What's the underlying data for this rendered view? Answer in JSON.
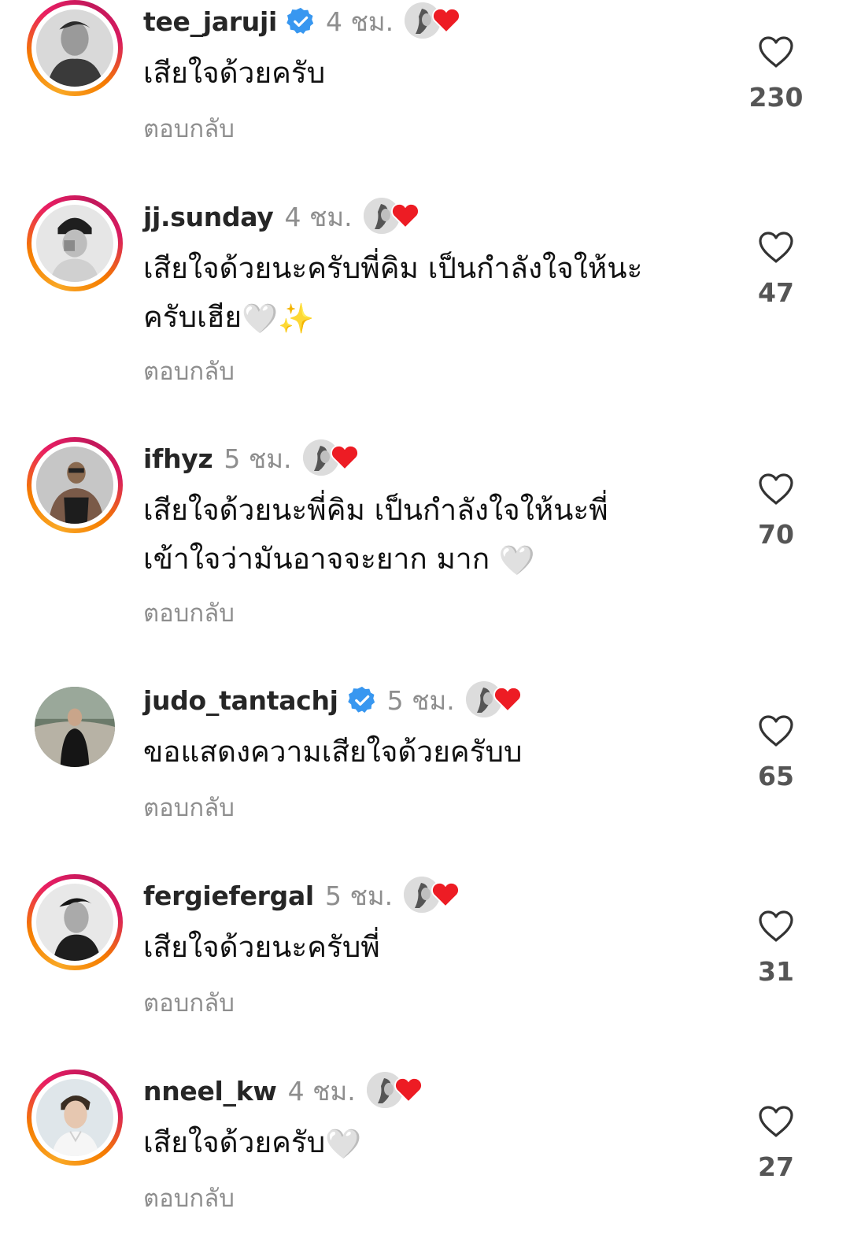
{
  "comments": [
    {
      "username": "tee_jaruji",
      "verified": true,
      "time": "4 ชม.",
      "text": "เสียใจด้วยครับ",
      "emoji_suffix": "",
      "reply_label": "ตอบกลับ",
      "likes": "230",
      "story_ring": true
    },
    {
      "username": "jj.sunday",
      "verified": false,
      "time": "4 ชม.",
      "text_line1": "เสียใจด้วยนะครับพี่คิม เป็นกำลังใจให้นะ",
      "text_line2": "ครับเฮีย",
      "emoji_suffix": "🤍✨",
      "reply_label": "ตอบกลับ",
      "likes": "47",
      "story_ring": true
    },
    {
      "username": "ifhyz",
      "verified": false,
      "time": "5 ชม.",
      "text_line1": "เสียใจด้วยนะพี่คิม เป็นกำลังใจให้นะพี่",
      "text_line2": "เข้าใจว่ามันอาจจะยาก มาก",
      "emoji_suffix": "🤍",
      "reply_label": "ตอบกลับ",
      "likes": "70",
      "story_ring": true
    },
    {
      "username": "judo_tantachj",
      "verified": true,
      "time": "5 ชม.",
      "text": "ขอแสดงความเสียใจด้วยครับบ",
      "emoji_suffix": "",
      "reply_label": "ตอบกลับ",
      "likes": "65",
      "story_ring": false
    },
    {
      "username": "fergiefergal",
      "verified": false,
      "time": "5 ชม.",
      "text": "เสียใจด้วยนะครับพี่",
      "emoji_suffix": "",
      "reply_label": "ตอบกลับ",
      "likes": "31",
      "story_ring": true
    },
    {
      "username": "nneel_kw",
      "verified": false,
      "time": "4 ชม.",
      "text": "เสียใจด้วยครับ",
      "emoji_suffix": "🤍",
      "reply_label": "ตอบกลับ",
      "likes": "27",
      "story_ring": true
    }
  ],
  "icons": {
    "like": "heart-outline-icon",
    "verified": "verified-badge-icon",
    "author_like": "author-liked-heart-icon"
  },
  "colors": {
    "verified_blue": "#3897f0",
    "heart_red": "#ed1c24",
    "muted_text": "#8e8e8e"
  }
}
